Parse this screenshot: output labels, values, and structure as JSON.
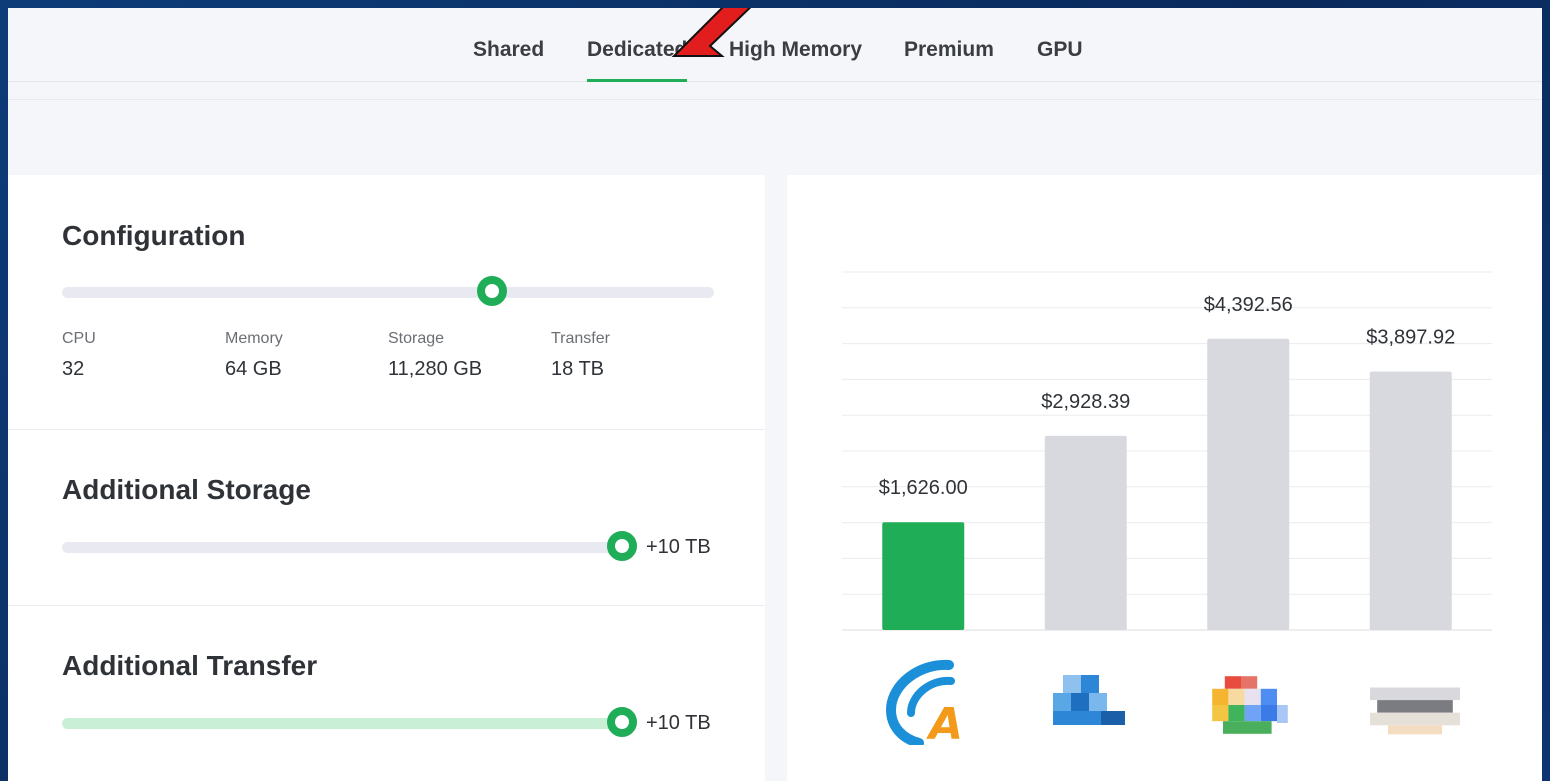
{
  "colors": {
    "accent": "#1fae57",
    "bar_other": "#d8d9de",
    "annotation_arrow": "#e11d1d"
  },
  "tabs": [
    {
      "label": "Shared",
      "active": false
    },
    {
      "label": "Dedicated",
      "active": true
    },
    {
      "label": "High Memory",
      "active": false
    },
    {
      "label": "Premium",
      "active": false
    },
    {
      "label": "GPU",
      "active": false
    }
  ],
  "configuration": {
    "title": "Configuration",
    "slider_level": 0.66,
    "specs": [
      {
        "label": "CPU",
        "value": "32"
      },
      {
        "label": "Memory",
        "value": "64 GB"
      },
      {
        "label": "Storage",
        "value": "11,280 GB"
      },
      {
        "label": "Transfer",
        "value": "18 TB"
      }
    ]
  },
  "additional_storage": {
    "title": "Additional Storage",
    "value": "+10 TB",
    "slider_level": 1.0
  },
  "additional_transfer": {
    "title": "Additional Transfer",
    "value": "+10 TB",
    "slider_level": 1.0
  },
  "chart_data": {
    "type": "bar",
    "categories": [
      "provider-1",
      "provider-2",
      "provider-3",
      "provider-4"
    ],
    "values": [
      1626.0,
      2928.39,
      4392.56,
      3897.92
    ],
    "value_labels": [
      "$1,626.00",
      "$2,928.39",
      "$4,392.56",
      "$3,897.92"
    ],
    "highlight_index": 0,
    "ylim": [
      0,
      5400
    ],
    "grid": true,
    "logos": [
      "brand-a-logo",
      "blurred-logo",
      "blurred-colorful-logo",
      "blurred-logo"
    ]
  }
}
